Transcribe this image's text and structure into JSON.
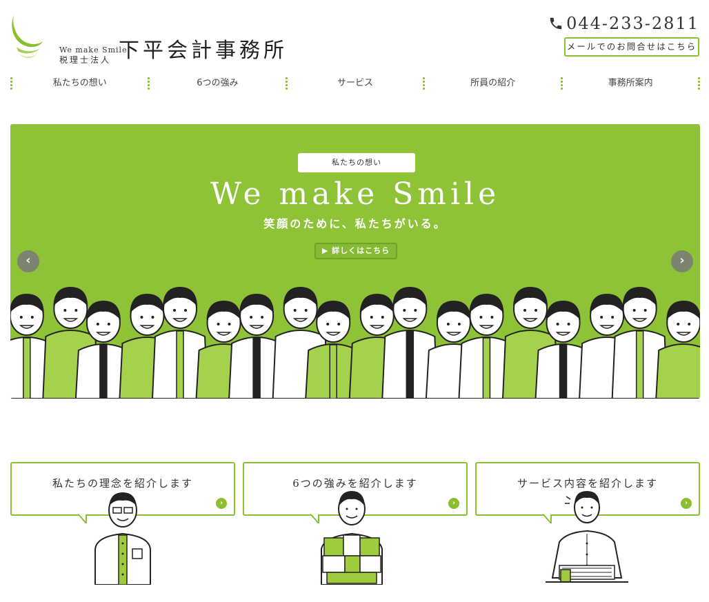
{
  "header": {
    "logo_tagline": "We make Smile",
    "logo_corp_type": "税理士法人",
    "logo_name": "下平会計事務所",
    "phone": "044-233-2811",
    "mail_button": "メールでのお問合せはこちら"
  },
  "nav": {
    "items": [
      "私たちの想い",
      "6つの強み",
      "サービス",
      "所員の紹介",
      "事務所案内"
    ]
  },
  "hero": {
    "tag": "私たちの想い",
    "title": "We make Smile",
    "subtitle": "笑顔のために、私たちがいる。",
    "detail_button": "▶ 詳しくはこちら",
    "prev_arrow": "‹",
    "next_arrow": "›"
  },
  "cards": [
    {
      "title": "私たちの理念を紹介します",
      "go": "›"
    },
    {
      "title": "6つの強みを紹介します",
      "go": "›"
    },
    {
      "title": "サービス内容を紹介します",
      "go": "›"
    }
  ],
  "colors": {
    "accent": "#8cbf2f",
    "hero_bg": "#8ec237"
  },
  "icons": [
    "logo-mark-icon",
    "phone-icon",
    "prev-arrow-icon",
    "next-arrow-icon",
    "card-arrow-icon"
  ]
}
